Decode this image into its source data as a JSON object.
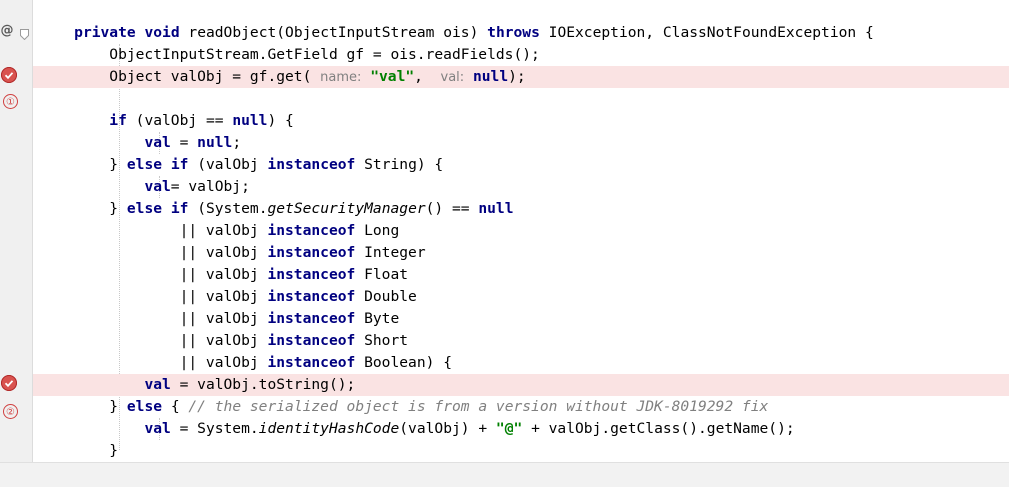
{
  "gutter": {
    "override_marker": "@",
    "annotations": [
      "①",
      "②"
    ]
  },
  "code": [
    [
      {
        "t": "    "
      },
      {
        "t": "private",
        "c": "kw"
      },
      {
        "t": " "
      },
      {
        "t": "void",
        "c": "kw"
      },
      {
        "t": " readObject(ObjectInputStream ois) "
      },
      {
        "t": "throws",
        "c": "kw"
      },
      {
        "t": " IOException, ClassNotFoundException {"
      }
    ],
    [
      {
        "t": "        ObjectInputStream.GetField gf = ois.readFields();"
      }
    ],
    [
      {
        "t": "        Object valObj = gf.get( "
      },
      {
        "t": "name:",
        "c": "hint"
      },
      {
        "t": " "
      },
      {
        "t": "\"val\"",
        "c": "str"
      },
      {
        "t": ",  "
      },
      {
        "t": "val:",
        "c": "hint"
      },
      {
        "t": " "
      },
      {
        "t": "null",
        "c": "kw"
      },
      {
        "t": ");"
      }
    ],
    [
      {
        "t": ""
      }
    ],
    [
      {
        "t": "        "
      },
      {
        "t": "if",
        "c": "kw"
      },
      {
        "t": " (valObj == "
      },
      {
        "t": "null",
        "c": "kw"
      },
      {
        "t": ") {"
      }
    ],
    [
      {
        "t": "            "
      },
      {
        "t": "val",
        "c": "kw"
      },
      {
        "t": " = "
      },
      {
        "t": "null",
        "c": "kw"
      },
      {
        "t": ";"
      }
    ],
    [
      {
        "t": "        } "
      },
      {
        "t": "else",
        "c": "kw"
      },
      {
        "t": " "
      },
      {
        "t": "if",
        "c": "kw"
      },
      {
        "t": " (valObj "
      },
      {
        "t": "instanceof",
        "c": "kw"
      },
      {
        "t": " String) {"
      }
    ],
    [
      {
        "t": "            "
      },
      {
        "t": "val",
        "c": "kw"
      },
      {
        "t": "= valObj;"
      }
    ],
    [
      {
        "t": "        } "
      },
      {
        "t": "else",
        "c": "kw"
      },
      {
        "t": " "
      },
      {
        "t": "if",
        "c": "kw"
      },
      {
        "t": " (System."
      },
      {
        "t": "getSecurityManager",
        "c": "it"
      },
      {
        "t": "() == "
      },
      {
        "t": "null",
        "c": "kw"
      }
    ],
    [
      {
        "t": "                || valObj "
      },
      {
        "t": "instanceof",
        "c": "kw"
      },
      {
        "t": " Long"
      }
    ],
    [
      {
        "t": "                || valObj "
      },
      {
        "t": "instanceof",
        "c": "kw"
      },
      {
        "t": " Integer"
      }
    ],
    [
      {
        "t": "                || valObj "
      },
      {
        "t": "instanceof",
        "c": "kw"
      },
      {
        "t": " Float"
      }
    ],
    [
      {
        "t": "                || valObj "
      },
      {
        "t": "instanceof",
        "c": "kw"
      },
      {
        "t": " Double"
      }
    ],
    [
      {
        "t": "                || valObj "
      },
      {
        "t": "instanceof",
        "c": "kw"
      },
      {
        "t": " Byte"
      }
    ],
    [
      {
        "t": "                || valObj "
      },
      {
        "t": "instanceof",
        "c": "kw"
      },
      {
        "t": " Short"
      }
    ],
    [
      {
        "t": "                || valObj "
      },
      {
        "t": "instanceof",
        "c": "kw"
      },
      {
        "t": " Boolean) {"
      }
    ],
    [
      {
        "t": "            "
      },
      {
        "t": "val",
        "c": "kw"
      },
      {
        "t": " = valObj.toString();"
      }
    ],
    [
      {
        "t": "        } "
      },
      {
        "t": "else",
        "c": "kw"
      },
      {
        "t": " { "
      },
      {
        "t": "// the serialized object is from a version without JDK-8019292 fix",
        "c": "cmt"
      }
    ],
    [
      {
        "t": "            "
      },
      {
        "t": "val",
        "c": "kw"
      },
      {
        "t": " = System."
      },
      {
        "t": "identityHashCode",
        "c": "it"
      },
      {
        "t": "(valObj) + "
      },
      {
        "t": "\"@\"",
        "c": "str"
      },
      {
        "t": " + valObj.getClass().getName();"
      }
    ],
    [
      {
        "t": "        }"
      }
    ]
  ],
  "colors": {
    "keyword": "#000080",
    "string": "#008000",
    "comment": "#808080",
    "breakpoint_line": "#fae3e3",
    "breakpoint": "#d9534f"
  },
  "icons": {
    "override": "override-at-icon",
    "fold": "fold-marker-icon",
    "breakpoint": "breakpoint-icon"
  }
}
